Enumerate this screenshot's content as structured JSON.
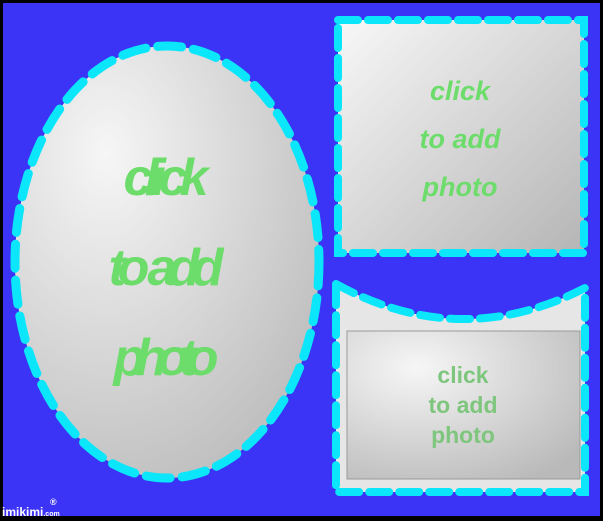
{
  "colors": {
    "background": "#3b33f5",
    "dash": "#0be6fb",
    "text_green": "#6cdc6a",
    "text_green_soft": "#7ec67d"
  },
  "frames": [
    {
      "shape": "oval",
      "lines": [
        "click",
        "to add",
        "photo"
      ]
    },
    {
      "shape": "square",
      "lines": [
        "click",
        "to add",
        "photo"
      ]
    },
    {
      "shape": "rectangle-curved-top",
      "lines": [
        "click",
        "to add",
        "photo"
      ]
    }
  ],
  "watermark": {
    "brand": "imikimi",
    "registered": "®",
    "suffix": ".com"
  }
}
